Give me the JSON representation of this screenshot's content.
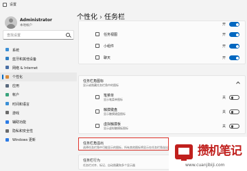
{
  "window": {
    "title": "设置"
  },
  "account": {
    "name": "Administrator",
    "type": "本地帐户"
  },
  "search": {
    "placeholder": "查找设置"
  },
  "nav": [
    {
      "label": "系统",
      "icon": "system-icon",
      "color": "#3b8fd6"
    },
    {
      "label": "蓝牙和其他设备",
      "icon": "bluetooth-icon",
      "color": "#2f7fc4"
    },
    {
      "label": "网络 & Internet",
      "icon": "network-icon",
      "color": "#4a6fa5"
    },
    {
      "label": "个性化",
      "icon": "personalization-icon",
      "color": "#d88b3b"
    },
    {
      "label": "应用",
      "icon": "apps-icon",
      "color": "#5a6a7e"
    },
    {
      "label": "帐户",
      "icon": "accounts-icon",
      "color": "#3aa37c"
    },
    {
      "label": "时间和语言",
      "icon": "time-language-icon",
      "color": "#3b8fd6"
    },
    {
      "label": "游戏",
      "icon": "gaming-icon",
      "color": "#6b6b6b"
    },
    {
      "label": "辅助功能",
      "icon": "accessibility-icon",
      "color": "#2c7be5"
    },
    {
      "label": "隐私和安全性",
      "icon": "privacy-icon",
      "color": "#6b6b6b"
    },
    {
      "label": "Windows 更新",
      "icon": "windows-update-icon",
      "color": "#2c7be5"
    }
  ],
  "breadcrumb": {
    "parent": "个性化",
    "separator": "›",
    "current": "任务栏"
  },
  "taskbar_items": [
    {
      "label": "任务视图",
      "icon": "task-view-icon",
      "state": "开",
      "on": true
    },
    {
      "label": "小组件",
      "icon": "widgets-icon",
      "state": "开",
      "on": true
    },
    {
      "label": "聊天",
      "icon": "chat-icon",
      "state": "开",
      "on": true
    }
  ],
  "first_row_state": "开",
  "corner_icons": {
    "title": "任务栏角图标",
    "description": "显示或隐藏任务栏角中的图标",
    "items": [
      {
        "label": "笔菜单",
        "desc": "显示笔菜单图标",
        "icon": "pen-menu-icon",
        "state": "关",
        "on": false
      },
      {
        "label": "触摸键盘",
        "desc": "显示触摸键盘图标",
        "icon": "touch-keyboard-icon",
        "state": "关",
        "on": false
      },
      {
        "label": "虚拟触摸板",
        "desc": "显示虚拟触摸板图标",
        "icon": "virtual-touchpad-icon",
        "state": "关",
        "on": false
      }
    ]
  },
  "overflow": {
    "title": "任务栏角溢出",
    "description": "选择任务栏角中可能显示的图标，所有其他图标将显示在任务栏角溢出菜单中"
  },
  "behaviors": {
    "title": "任务栏行为",
    "description": "任务栏对齐、标记、自动隐藏和多个显示器"
  },
  "watermark": {
    "text": "攒机笔记",
    "url": "www.cuanjibiji.com"
  },
  "colors": {
    "accent": "#0067c0",
    "highlight": "#e0332b",
    "watermark": "#c0201d"
  }
}
